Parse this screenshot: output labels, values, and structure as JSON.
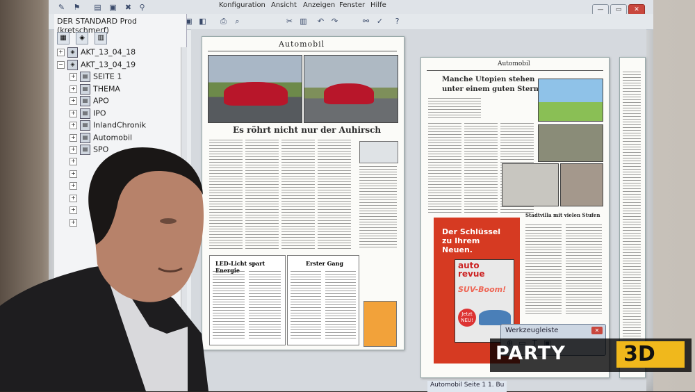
{
  "menubar": {
    "items": [
      "Konfiguration",
      "Ansicht",
      "Anzeigen",
      "Fenster",
      "Hilfe"
    ]
  },
  "window_controls": {
    "minimize": "—",
    "maximize": "▭",
    "close": "✕"
  },
  "sidebar": {
    "title": "DER STANDARD Prod (kretschmerf)",
    "tabs": [
      "▦",
      "◈",
      "▥"
    ],
    "tree": [
      {
        "label": "AKT_13_04_18",
        "level": 0
      },
      {
        "label": "AKT_13_04_19",
        "level": 0
      },
      {
        "label": "SEITE 1",
        "level": 1
      },
      {
        "label": "THEMA",
        "level": 1
      },
      {
        "label": "APO",
        "level": 1
      },
      {
        "label": "IPO",
        "level": 1
      },
      {
        "label": "InlandChronik",
        "level": 1
      },
      {
        "label": "Automobil",
        "level": 1
      },
      {
        "label": "SPO",
        "level": 1
      }
    ]
  },
  "left_page": {
    "section": "Automobil",
    "headline": "Es röhrt nicht nur der Auhirsch",
    "box1_title": "LED-Licht spart Energie",
    "box2_title": "Erster Gang"
  },
  "right_page": {
    "section": "Automobil",
    "headline_line1": "Manche Utopien stehen",
    "headline_line2": "unter einem guten Stern",
    "subhead": "Stadtvilla mit vielen Stufen",
    "ad": {
      "line1": "Der Schlüssel",
      "line2": "zu Ihrem Neuen.",
      "mag_title_1": "auto",
      "mag_title_2": "revue",
      "mag_sub": "SUV-Boom!",
      "badge": "Jetzt NEU!"
    }
  },
  "toolwindow": {
    "title": "Werkzeugleiste",
    "close": "✕"
  },
  "statusbar": {
    "text": "Automobil  Seite 1  1. Bu"
  },
  "watermark": {
    "text_a": "PARTY",
    "text_b": "3D"
  }
}
